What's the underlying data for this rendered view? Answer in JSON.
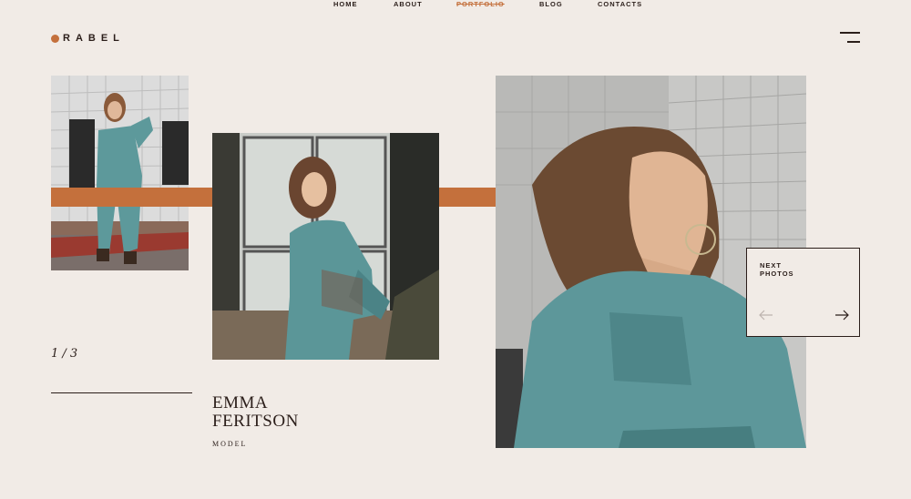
{
  "brand": {
    "logo_text": "RABEL",
    "accent": "#c4703c"
  },
  "nav": {
    "items": [
      {
        "label": "HOME",
        "active": false
      },
      {
        "label": "ABOUT",
        "active": false
      },
      {
        "label": "PORTFOLIO",
        "active": true
      },
      {
        "label": "BLOG",
        "active": false
      },
      {
        "label": "CONTACTS",
        "active": false
      }
    ]
  },
  "slider": {
    "counter": "1 / 3"
  },
  "model": {
    "name_line1": "EMMA",
    "name_line2": "FERITSON",
    "role": "MODEL"
  },
  "next": {
    "label": "NEXT\nPHOTOS"
  },
  "colors": {
    "background": "#f1ebe6",
    "text": "#2b1e1a",
    "denim": "#4f8a8f"
  }
}
